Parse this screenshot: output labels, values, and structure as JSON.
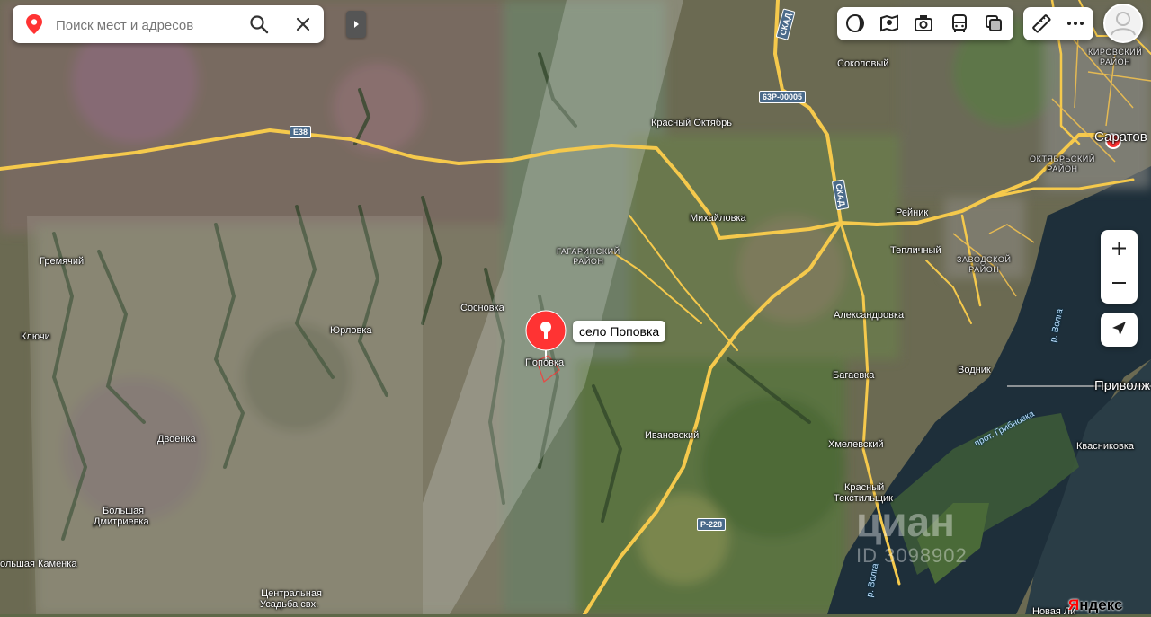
{
  "search": {
    "placeholder": "Поиск мест и адресов",
    "icons": [
      "location-pin-icon",
      "search-icon",
      "close-icon"
    ]
  },
  "toolbar": {
    "icons": [
      "layers-icon",
      "map-layers-icon",
      "panorama-icon",
      "transport-icon",
      "traffic-icon",
      "ruler-icon",
      "more-icon"
    ]
  },
  "zoom": {
    "in": "+",
    "out": "–"
  },
  "marker": {
    "label": "село Поповка"
  },
  "places": [
    {
      "id": "sokolovy",
      "text": "Соколовый"
    },
    {
      "id": "krasny-oktyabr",
      "text": "Красный Октябрь"
    },
    {
      "id": "mikhaylovka",
      "text": "Михайловка"
    },
    {
      "id": "reynik",
      "text": "Рейник"
    },
    {
      "id": "teplichny",
      "text": "Тепличный"
    },
    {
      "id": "gremyachiy",
      "text": "Гремячий"
    },
    {
      "id": "sosnovka",
      "text": "Сосновка"
    },
    {
      "id": "yurlovka",
      "text": "Юрловка"
    },
    {
      "id": "klyuchi",
      "text": "Ключи"
    },
    {
      "id": "popovka",
      "text": "Поповка"
    },
    {
      "id": "aleksandrovka",
      "text": "Александровка"
    },
    {
      "id": "bagaevka",
      "text": "Багаевка"
    },
    {
      "id": "vodnik",
      "text": "Водник"
    },
    {
      "id": "ivanovsky",
      "text": "Ивановский"
    },
    {
      "id": "khmelevsky",
      "text": "Хмелевский"
    },
    {
      "id": "krasny-tekstilshchik-1",
      "text": "Красный"
    },
    {
      "id": "krasny-tekstilshchik-2",
      "text": "Текстильщик"
    },
    {
      "id": "dvoenka",
      "text": "Двоенка"
    },
    {
      "id": "bolshaya-dmitrievka-1",
      "text": "Большая"
    },
    {
      "id": "bolshaya-dmitrievka-2",
      "text": "Дмитриевка"
    },
    {
      "id": "bolshaya-kamenka",
      "text": "ольшая Каменка"
    },
    {
      "id": "tsentralnaya-usadba-1",
      "text": "Центральная"
    },
    {
      "id": "tsentralnaya-usadba-2",
      "text": "Усадьба свх."
    },
    {
      "id": "kvasnikovka",
      "text": "Квасниковка"
    },
    {
      "id": "novaya-lipovka",
      "text": "Новая Ли"
    }
  ],
  "big_places": [
    {
      "id": "saratov",
      "text": "Саратов"
    },
    {
      "id": "privolzhsky",
      "text": "Приволж"
    }
  ],
  "districts": [
    {
      "id": "kirovsky",
      "lines": [
        "КИРОВСКИЙ",
        "РАЙОН"
      ]
    },
    {
      "id": "oktyabrsky",
      "lines": [
        "ОКТЯБРЬСКИЙ",
        "РАЙОН"
      ]
    },
    {
      "id": "gagarinsky",
      "lines": [
        "ГАГАРИНСКИЙ",
        "РАЙОН"
      ]
    },
    {
      "id": "zavodskoy",
      "lines": [
        "ЗАВОДСКОЙ",
        "РАЙОН"
      ]
    }
  ],
  "rivers": [
    {
      "id": "volga-1",
      "text": "р. Волга"
    },
    {
      "id": "volga-2",
      "text": "р. Волга"
    },
    {
      "id": "grebnovka",
      "text": "прот. Грибновка"
    }
  ],
  "roads": [
    {
      "id": "e38",
      "text": "E38"
    },
    {
      "id": "63r",
      "text": "63Р-00005"
    },
    {
      "id": "r228",
      "text": "Р-228"
    },
    {
      "id": "skad-1",
      "text": "СКАД"
    },
    {
      "id": "skad-2",
      "text": "СКАД"
    }
  ],
  "watermark": {
    "brand": "циан",
    "id": "ID 3098902"
  },
  "attribution": {
    "brand_first": "Я",
    "brand_rest": "ндекс"
  },
  "colors": {
    "marker": "#ff3333",
    "road": "#f5c94c",
    "city_dot": "#ff3333"
  }
}
